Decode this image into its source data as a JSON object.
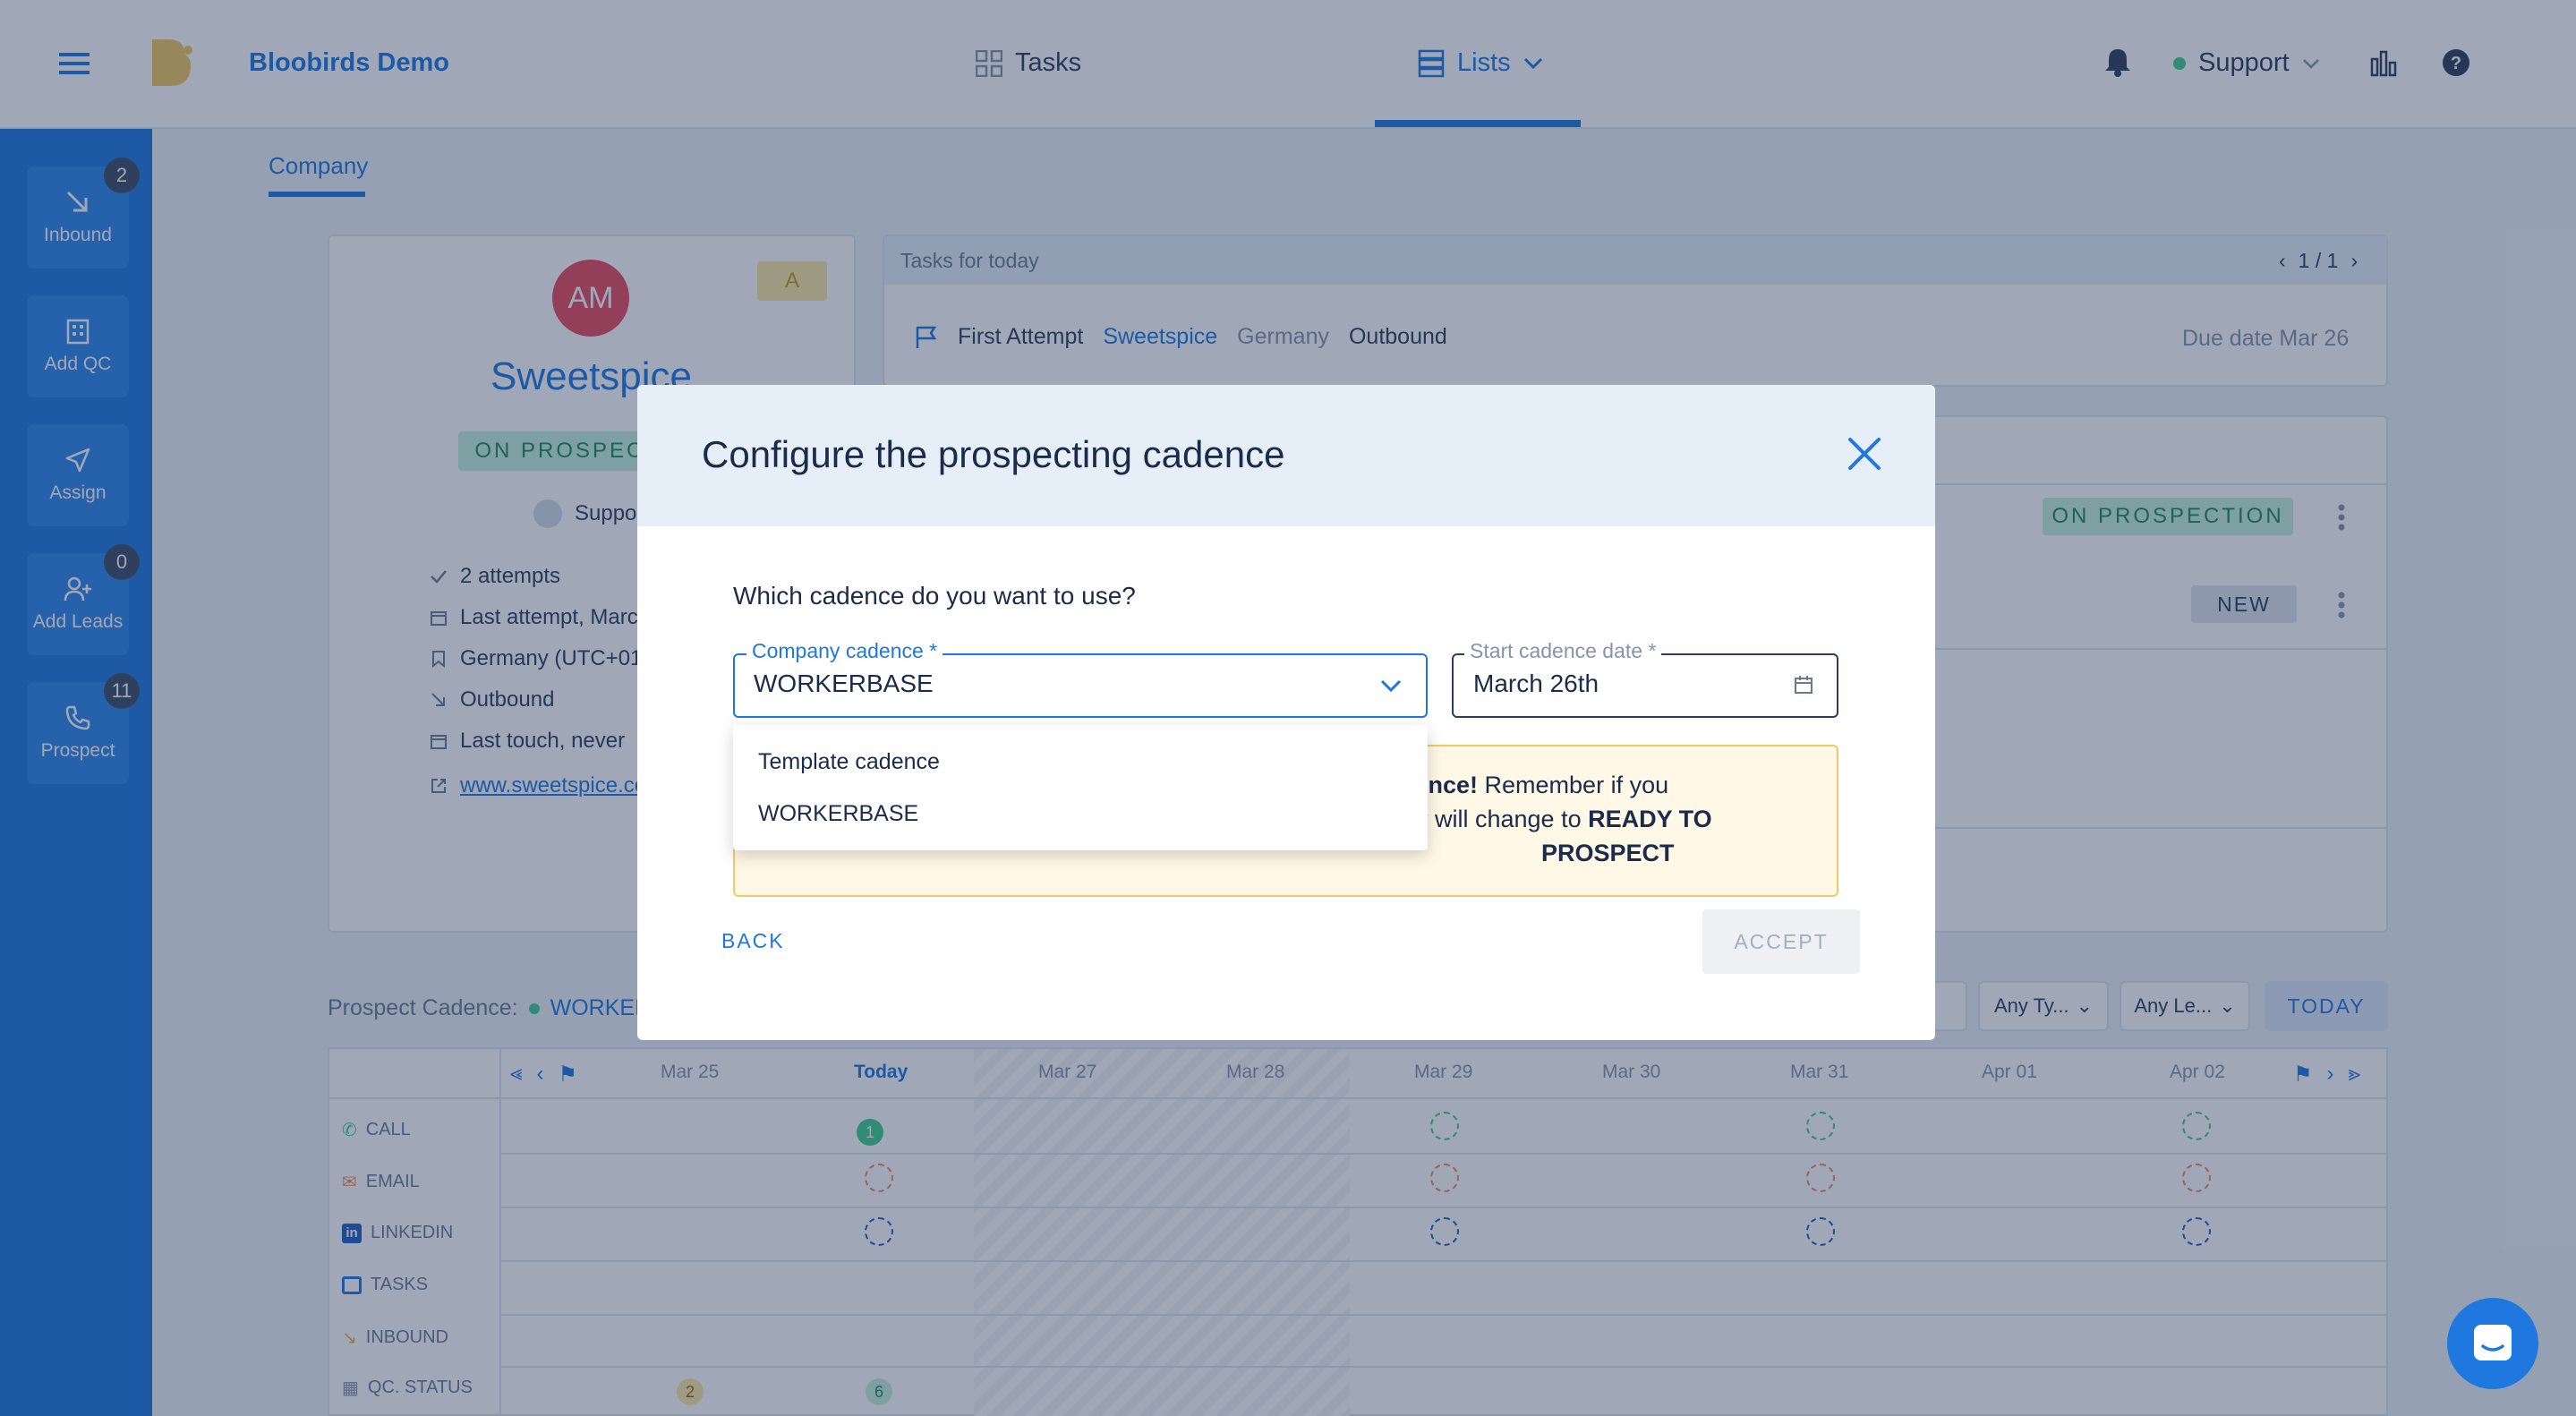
{
  "app": {
    "brand": "Bloobirds Demo"
  },
  "topnav": {
    "tasks": "Tasks",
    "lists": "Lists",
    "user": "Support"
  },
  "sidebar": {
    "items": [
      {
        "label": "Inbound",
        "badge": "2"
      },
      {
        "label": "Add QC",
        "badge": ""
      },
      {
        "label": "Assign",
        "badge": ""
      },
      {
        "label": "Add Leads",
        "badge": "0"
      },
      {
        "label": "Prospect",
        "badge": "11"
      }
    ]
  },
  "page": {
    "tab": "Company",
    "company": {
      "initials": "AM",
      "name": "Sweetspice",
      "grade": "A",
      "status": "ON PROSPECTION",
      "owner": "Support",
      "info": [
        "2 attempts",
        "Last attempt, March 26",
        "Germany (UTC+01:00)",
        "Outbound",
        "Last touch, never",
        "www.sweetspice.com"
      ]
    },
    "tasks": {
      "header": "Tasks for today",
      "pager": "1 / 1",
      "task": {
        "type": "First Attempt",
        "company": "Sweetspice",
        "country": "Germany",
        "source": "Outbound",
        "due": "Due date Mar 26"
      }
    },
    "statuses": [
      "ON PROSPECTION",
      "NEW"
    ],
    "cadence": {
      "label": "Prospect Cadence:",
      "name": "WORKERBASE",
      "filters": [
        "Any Ty...",
        "Any Le..."
      ],
      "today_btn": "TODAY",
      "days": [
        "Mar 25",
        "Today",
        "Mar 27",
        "Mar 28",
        "Mar 29",
        "Mar 30",
        "Mar 31",
        "Apr 01",
        "Apr 02"
      ],
      "rows": [
        "CALL",
        "EMAIL",
        "LINKEDIN",
        "TASKS",
        "INBOUND",
        "QC. STATUS"
      ],
      "call_count": "1",
      "qc_counts": [
        "2",
        "6"
      ]
    }
  },
  "modal": {
    "title": "Configure the prospecting cadence",
    "question": "Which cadence do you want to use?",
    "cadence_field": {
      "label": "Company cadence *",
      "value": "WORKERBASE"
    },
    "date_field": {
      "label": "Start cadence date *",
      "value": "March 26th"
    },
    "dropdown_options": [
      "Template cadence",
      "WORKERBASE"
    ],
    "notice": {
      "bold1": "dence!",
      "text1": " Remember if you",
      "text2": "y will change to ",
      "bold2": "READY TO",
      "bold3": "PROSPECT"
    },
    "back": "BACK",
    "accept": "ACCEPT"
  },
  "colors": {
    "primary": "#1f77e0",
    "sidebar": "#1f77e0",
    "overlay": "rgba(29,48,84,0.42)",
    "notice_bg": "#fff8e6",
    "notice_border": "#f6c765"
  }
}
